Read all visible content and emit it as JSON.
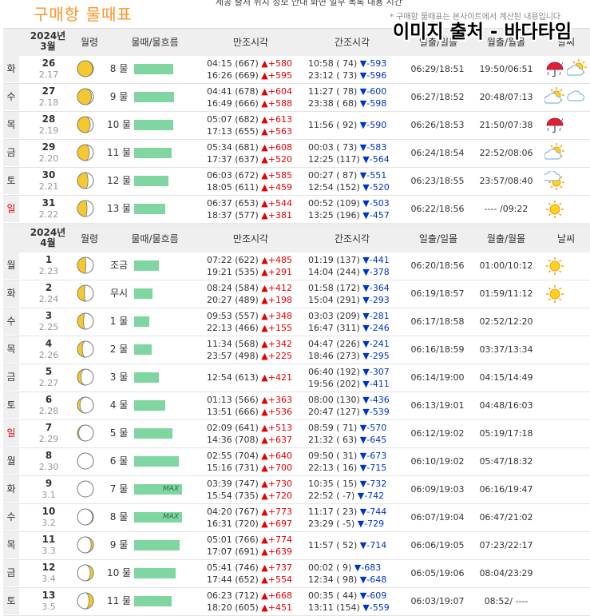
{
  "title": "구매항 물때표",
  "topline": "제공 출처 위치 정보 안내 화면 일부 목록 내용 시간",
  "note": "* 구매항 물때표는 본사이트에서 계산된 내용입니다",
  "watermark": "이미지 출처 - 바다타임",
  "columns": {
    "moon_phase": "월령",
    "tide_flow": "물때/물흐름",
    "high_tide": "만조시각",
    "low_tide": "간조시각",
    "sun": "일출/일몰",
    "moon": "월출/월몰",
    "weather": "날씨"
  },
  "colors": {
    "title": "#ff9326",
    "rise": "#e60000",
    "fall": "#0033cc",
    "bar": "#7fd6a0",
    "moon": "#f5c830",
    "header_bg": "#efefef"
  },
  "march": {
    "year": "2024년",
    "month": "3월",
    "rows": [
      {
        "dow": "화",
        "day": "26",
        "lunar": "2.17",
        "phase": 0.52,
        "tide": "8 물",
        "flow": 0.63,
        "max": "",
        "high": [
          {
            "time": "04:15 (667)",
            "diff": "▲+580"
          },
          {
            "time": "16:26 (669)",
            "diff": "▲+595"
          }
        ],
        "low": [
          {
            "time": "10:58 ( 74)",
            "diff": "▼-593"
          },
          {
            "time": "23:12 ( 73)",
            "diff": "▼-596"
          }
        ],
        "sun": "06:29/18:51",
        "moon": "19:50/06:51",
        "weather": [
          "umbrella-rain-icon",
          "cloud-sun-icon"
        ],
        "sunday": false
      },
      {
        "dow": "수",
        "day": "27",
        "lunar": "2.18",
        "phase": 0.56,
        "tide": "9 물",
        "flow": 0.64,
        "max": "",
        "high": [
          {
            "time": "04:41 (678)",
            "diff": "▲+604"
          },
          {
            "time": "16:49 (666)",
            "diff": "▲+588"
          }
        ],
        "low": [
          {
            "time": "11:27 ( 78)",
            "diff": "▼-600"
          },
          {
            "time": "23:38 ( 68)",
            "diff": "▼-598"
          }
        ],
        "sun": "06:27/18:52",
        "moon": "20:48/07:13",
        "weather": [
          "cloud-sun-icon",
          "cloud-icon"
        ],
        "sunday": false
      },
      {
        "dow": "목",
        "day": "28",
        "lunar": "2.19",
        "phase": 0.6,
        "tide": "10 물",
        "flow": 0.63,
        "max": "",
        "high": [
          {
            "time": "05:07 (682)",
            "diff": "▲+613"
          },
          {
            "time": "17:13 (655)",
            "diff": "▲+563"
          }
        ],
        "low": [
          {
            "time": "11:56 ( 92)",
            "diff": "▼-590"
          }
        ],
        "sun": "06:26/18:53",
        "moon": "21:50/07:38",
        "weather": [
          "umbrella-rain-icon"
        ],
        "sunday": false
      },
      {
        "dow": "금",
        "day": "29",
        "lunar": "2.20",
        "phase": 0.63,
        "tide": "11 물",
        "flow": 0.6,
        "max": "",
        "high": [
          {
            "time": "05:34 (681)",
            "diff": "▲+608"
          },
          {
            "time": "17:37 (637)",
            "diff": "▲+520"
          }
        ],
        "low": [
          {
            "time": "00:03 ( 73)",
            "diff": "▼-583"
          },
          {
            "time": "12:25 (117)",
            "diff": "▼-564"
          }
        ],
        "sun": "06:24/18:54",
        "moon": "22:52/08:06",
        "weather": [
          "cloud-sun-icon"
        ],
        "sunday": false
      },
      {
        "dow": "토",
        "day": "30",
        "lunar": "2.21",
        "phase": 0.67,
        "tide": "12 물",
        "flow": 0.55,
        "max": "",
        "high": [
          {
            "time": "06:03 (672)",
            "diff": "▲+585"
          },
          {
            "time": "18:05 (611)",
            "diff": "▲+459"
          }
        ],
        "low": [
          {
            "time": "00:27 ( 87)",
            "diff": "▼-551"
          },
          {
            "time": "12:54 (152)",
            "diff": "▼-520"
          }
        ],
        "sun": "06:23/18:55",
        "moon": "23:57/08:40",
        "weather": [
          "sun-cloud-icon"
        ],
        "sunday": false
      },
      {
        "dow": "일",
        "day": "31",
        "lunar": "2.22",
        "phase": 0.7,
        "tide": "13 물",
        "flow": 0.5,
        "max": "",
        "high": [
          {
            "time": "06:37 (653)",
            "diff": "▲+544"
          },
          {
            "time": "18:37 (577)",
            "diff": "▲+381"
          }
        ],
        "low": [
          {
            "time": "00:52 (109)",
            "diff": "▼-503"
          },
          {
            "time": "13:25 (196)",
            "diff": "▼-457"
          }
        ],
        "sun": "06:22/18:56",
        "moon": "---- /09:22",
        "weather": [
          "sun-icon"
        ],
        "sunday": true
      }
    ]
  },
  "april": {
    "year": "2024년",
    "month": "4월",
    "rows": [
      {
        "dow": "월",
        "day": "1",
        "lunar": "2.23",
        "phase": 0.74,
        "tide": "조금",
        "flow": 0.4,
        "max": "",
        "high": [
          {
            "time": "07:22 (622)",
            "diff": "▲+485"
          },
          {
            "time": "19:21 (535)",
            "diff": "▲+291"
          }
        ],
        "low": [
          {
            "time": "01:19 (137)",
            "diff": "▼-441"
          },
          {
            "time": "14:04 (244)",
            "diff": "▼-378"
          }
        ],
        "sun": "06:20/18:56",
        "moon": "01:00/10:12",
        "weather": [
          "sun-icon"
        ],
        "sunday": false
      },
      {
        "dow": "화",
        "day": "2",
        "lunar": "2.24",
        "phase": 0.78,
        "tide": "무시",
        "flow": 0.3,
        "max": "",
        "high": [
          {
            "time": "08:24 (584)",
            "diff": "▲+412"
          },
          {
            "time": "20:27 (489)",
            "diff": "▲+198"
          }
        ],
        "low": [
          {
            "time": "01:58 (172)",
            "diff": "▼-364"
          },
          {
            "time": "15:04 (291)",
            "diff": "▼-293"
          }
        ],
        "sun": "06:19/18:57",
        "moon": "01:59/11:12",
        "weather": [
          "sun-icon"
        ],
        "sunday": false
      },
      {
        "dow": "수",
        "day": "3",
        "lunar": "2.25",
        "phase": 0.81,
        "tide": "1 물",
        "flow": 0.24,
        "max": "",
        "high": [
          {
            "time": "09:53 (557)",
            "diff": "▲+348"
          },
          {
            "time": "22:13 (466)",
            "diff": "▲+155"
          }
        ],
        "low": [
          {
            "time": "03:03 (209)",
            "diff": "▼-281"
          },
          {
            "time": "16:47 (311)",
            "diff": "▼-246"
          }
        ],
        "sun": "06:17/18:58",
        "moon": "02:52/12:20",
        "weather": [],
        "sunday": false
      },
      {
        "dow": "목",
        "day": "4",
        "lunar": "2.26",
        "phase": 0.85,
        "tide": "2 물",
        "flow": 0.28,
        "max": "",
        "high": [
          {
            "time": "11:34 (568)",
            "diff": "▲+342"
          },
          {
            "time": "23:57 (498)",
            "diff": "▲+225"
          }
        ],
        "low": [
          {
            "time": "04:47 (226)",
            "diff": "▼-241"
          },
          {
            "time": "18:46 (273)",
            "diff": "▼-295"
          }
        ],
        "sun": "06:16/18:59",
        "moon": "03:37/13:34",
        "weather": [],
        "sunday": false
      },
      {
        "dow": "금",
        "day": "5",
        "lunar": "2.27",
        "phase": 0.89,
        "tide": "3 물",
        "flow": 0.4,
        "max": "",
        "high": [
          {
            "time": "12:54 (613)",
            "diff": "▲+421"
          }
        ],
        "low": [
          {
            "time": "06:40 (192)",
            "diff": "▼-307"
          },
          {
            "time": "19:56 (202)",
            "diff": "▼-411"
          }
        ],
        "sun": "06:14/19:00",
        "moon": "04:15/14:49",
        "weather": [],
        "sunday": false
      },
      {
        "dow": "토",
        "day": "6",
        "lunar": "2.28",
        "phase": 0.92,
        "tide": "4 물",
        "flow": 0.5,
        "max": "",
        "high": [
          {
            "time": "01:13 (566)",
            "diff": "▲+363"
          },
          {
            "time": "13:51 (666)",
            "diff": "▲+536"
          }
        ],
        "low": [
          {
            "time": "08:00 (130)",
            "diff": "▼-436"
          },
          {
            "time": "20:47 (127)",
            "diff": "▼-539"
          }
        ],
        "sun": "06:13/19:01",
        "moon": "04:48/16:03",
        "weather": [],
        "sunday": false
      },
      {
        "dow": "일",
        "day": "7",
        "lunar": "2.29",
        "phase": 0.96,
        "tide": "5 물",
        "flow": 0.62,
        "max": "",
        "high": [
          {
            "time": "02:09 (641)",
            "diff": "▲+513"
          },
          {
            "time": "14:36 (708)",
            "diff": "▲+637"
          }
        ],
        "low": [
          {
            "time": "08:59 ( 71)",
            "diff": "▼-570"
          },
          {
            "time": "21:32 ( 63)",
            "diff": "▼-645"
          }
        ],
        "sun": "06:12/19:02",
        "moon": "05:19/17:18",
        "weather": [],
        "sunday": true
      },
      {
        "dow": "월",
        "day": "8",
        "lunar": "2.30",
        "phase": 1.0,
        "tide": "6 물",
        "flow": 0.72,
        "max": "",
        "high": [
          {
            "time": "02:55 (704)",
            "diff": "▲+640"
          },
          {
            "time": "15:16 (731)",
            "diff": "▲+700"
          }
        ],
        "low": [
          {
            "time": "09:50 ( 31)",
            "diff": "▼-673"
          },
          {
            "time": "22:13 ( 16)",
            "diff": "▼-715"
          }
        ],
        "sun": "06:10/19:02",
        "moon": "05:47/18:32",
        "weather": [],
        "sunday": false
      },
      {
        "dow": "화",
        "day": "9",
        "lunar": "3.1",
        "phase": 0.0,
        "tide": "7 물",
        "flow": 0.77,
        "max": "MAX",
        "high": [
          {
            "time": "03:39 (747)",
            "diff": "▲+730"
          },
          {
            "time": "15:54 (735)",
            "diff": "▲+720"
          }
        ],
        "low": [
          {
            "time": "10:35 ( 15)",
            "diff": "▼-732"
          },
          {
            "time": "22:52 ( -7)",
            "diff": "▼-742"
          }
        ],
        "sun": "06:09/19:03",
        "moon": "06:16/19:47",
        "weather": [],
        "sunday": false
      },
      {
        "dow": "수",
        "day": "10",
        "lunar": "3.2",
        "phase": 0.03,
        "tide": "8 물",
        "flow": 0.77,
        "max": "MAX",
        "high": [
          {
            "time": "04:20 (767)",
            "diff": "▲+773"
          },
          {
            "time": "16:31 (720)",
            "diff": "▲+697"
          }
        ],
        "low": [
          {
            "time": "11:17 ( 23)",
            "diff": "▼-744"
          },
          {
            "time": "23:29 ( -5)",
            "diff": "▼-729"
          }
        ],
        "sun": "06:07/19:04",
        "moon": "06:47/21:02",
        "weather": [],
        "sunday": false
      },
      {
        "dow": "목",
        "day": "11",
        "lunar": "3.3",
        "phase": 0.07,
        "tide": "9 물",
        "flow": 0.73,
        "max": "",
        "high": [
          {
            "time": "05:01 (766)",
            "diff": "▲+774"
          },
          {
            "time": "17:07 (691)",
            "diff": "▲+639"
          }
        ],
        "low": [
          {
            "time": "11:57 ( 52)",
            "diff": "▼-714"
          }
        ],
        "sun": "06:06/19:05",
        "moon": "07:23/22:17",
        "weather": [],
        "sunday": false
      },
      {
        "dow": "금",
        "day": "12",
        "lunar": "3.4",
        "phase": 0.1,
        "tide": "10 물",
        "flow": 0.67,
        "max": "",
        "high": [
          {
            "time": "05:41 (746)",
            "diff": "▲+737"
          },
          {
            "time": "17:44 (652)",
            "diff": "▲+554"
          }
        ],
        "low": [
          {
            "time": "00:02 (  9)",
            "diff": "▼-683"
          },
          {
            "time": "12:34 ( 98)",
            "diff": "▼-648"
          }
        ],
        "sun": "06:05/19:06",
        "moon": "08:04/23:29",
        "weather": [],
        "sunday": false
      },
      {
        "dow": "토",
        "day": "13",
        "lunar": "3.5",
        "phase": 0.14,
        "tide": "11 물",
        "flow": 0.6,
        "max": "",
        "high": [
          {
            "time": "06:23 (712)",
            "diff": "▲+668"
          },
          {
            "time": "18:20 (605)",
            "diff": "▲+451"
          }
        ],
        "low": [
          {
            "time": "00:35 ( 44)",
            "diff": "▼-609"
          },
          {
            "time": "13:11 (154)",
            "diff": "▼-559"
          }
        ],
        "sun": "06:03/19:07",
        "moon": "08:52/ ----",
        "weather": [],
        "sunday": false
      }
    ]
  }
}
